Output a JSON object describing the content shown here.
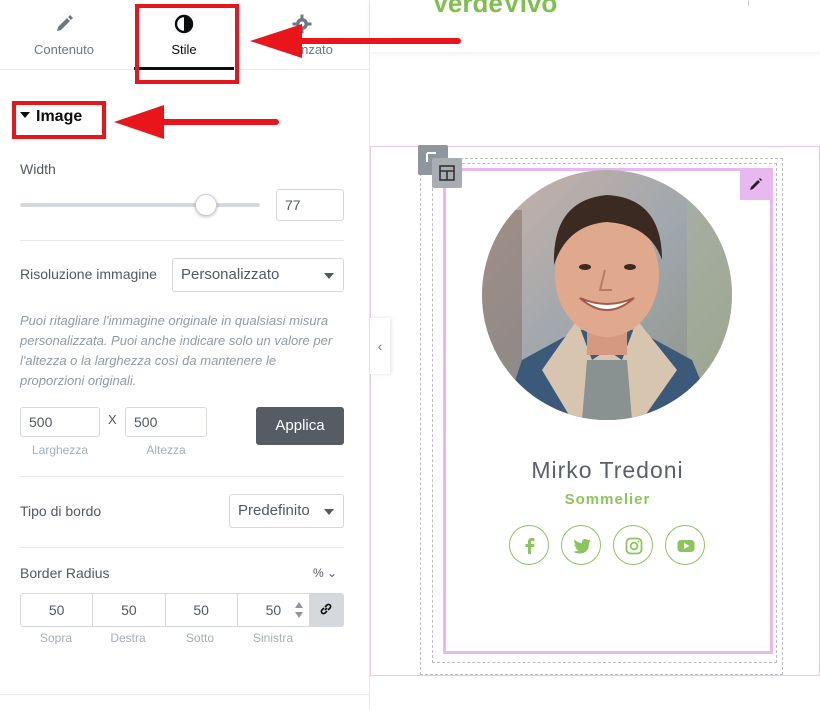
{
  "tabs": [
    {
      "label": "Contenuto",
      "icon": "pencil-icon"
    },
    {
      "label": "Stile",
      "icon": "contrast-icon"
    },
    {
      "label": "Avanzato",
      "icon": "gear-icon",
      "visible_text": "nzato"
    }
  ],
  "section": {
    "title": "Image"
  },
  "width": {
    "label": "Width",
    "value": "77",
    "slider_fraction": 0.77
  },
  "resolution": {
    "label": "Risoluzione immagine",
    "selected": "Personalizzato",
    "help": "Puoi ritagliare l'immagine originale in qualsiasi misura personalizzata. Puoi anche indicare solo un valore per l'altezza o la larghezza così da mantenere le proporzioni originali.",
    "width_value": "500",
    "height_value": "500",
    "separator": "X",
    "width_label": "Larghezza",
    "height_label": "Altezza",
    "apply_label": "Applica"
  },
  "border": {
    "label": "Tipo di bordo",
    "selected": "Predefinito"
  },
  "radius": {
    "label": "Border Radius",
    "unit": "% ⌄",
    "values": [
      "50",
      "50",
      "50",
      "50"
    ],
    "labels": [
      "Sopra",
      "Destra",
      "Sotto",
      "Sinistra"
    ]
  },
  "preview": {
    "logo_text": "VerdeVivo",
    "name": "Mirko Tredoni",
    "role": "Sommelier",
    "social_icons": [
      "facebook-icon",
      "twitter-icon",
      "instagram-icon",
      "youtube-icon"
    ]
  },
  "colors": {
    "accent_green": "#8cc45e",
    "annotation_red": "#e8151a",
    "selection_pink": "#e8b9f0"
  }
}
